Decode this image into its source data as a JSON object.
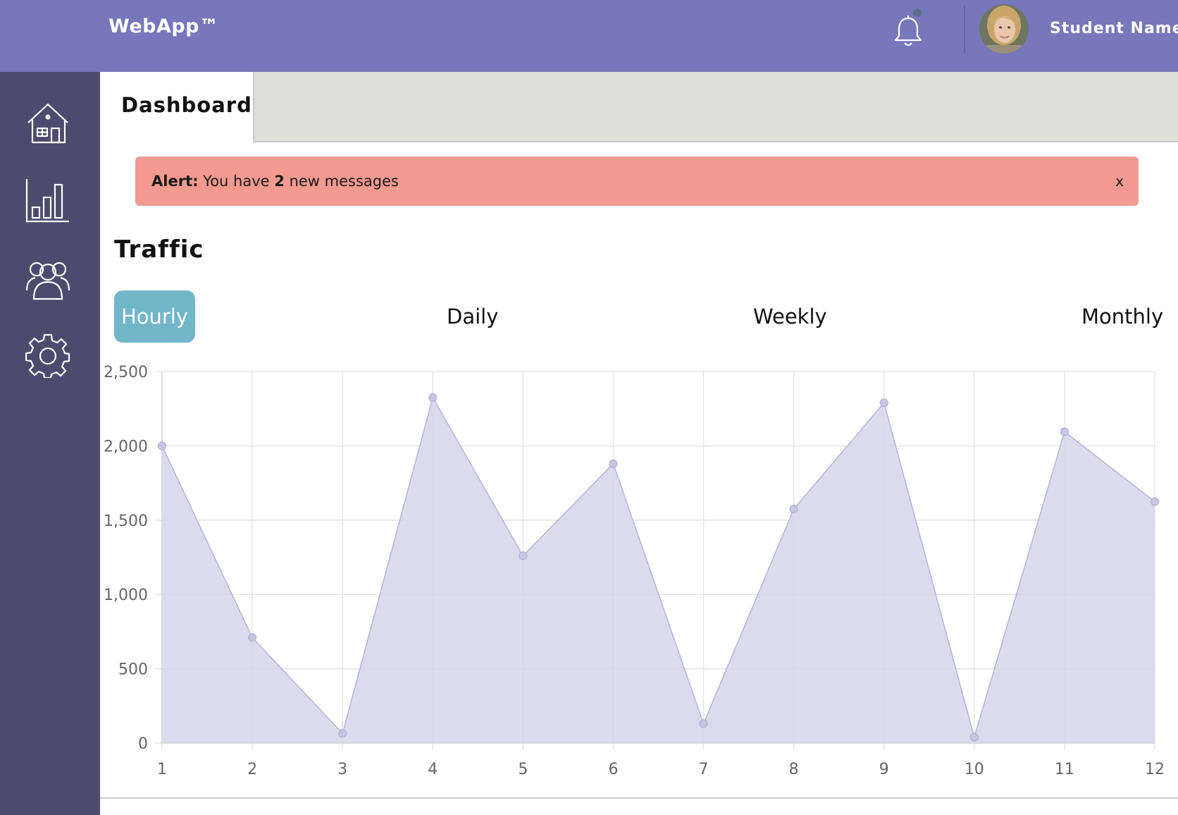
{
  "header": {
    "brand": "WebApp™",
    "user_name": "Student Name",
    "icons": [
      "bell-icon",
      "avatar"
    ]
  },
  "sidebar": {
    "items": [
      {
        "icon": "home-icon"
      },
      {
        "icon": "bar-chart-icon"
      },
      {
        "icon": "users-icon"
      },
      {
        "icon": "gear-icon"
      }
    ]
  },
  "tabs": {
    "active": "Dashboard"
  },
  "alert": {
    "label": "Alert:",
    "text_before": " You have ",
    "count": "2",
    "text_after": " new messages",
    "close": "x"
  },
  "traffic": {
    "title": "Traffic",
    "filters": {
      "hourly": "Hourly",
      "daily": "Daily",
      "weekly": "Weekly",
      "monthly": "Monthly"
    },
    "active_filter": "Hourly"
  },
  "colors": {
    "header": "#7777bb",
    "sidebar": "#4d4b6d",
    "alert": "#f49a90",
    "active_filter": "#71b6c9",
    "series_fill": "#d5d5ea",
    "series_line": "#b4b4db"
  },
  "chart_data": {
    "type": "area",
    "x": [
      1,
      2,
      3,
      4,
      5,
      6,
      7,
      8,
      9,
      10,
      11,
      12
    ],
    "values": [
      2000,
      710,
      65,
      2325,
      1260,
      1880,
      130,
      1575,
      2290,
      40,
      2095,
      1625
    ],
    "ylim": [
      0,
      2500
    ],
    "yticks": [
      0,
      500,
      1000,
      1500,
      2000,
      2500
    ],
    "ytick_labels": [
      "0",
      "500",
      "1,000",
      "1,500",
      "2,000",
      "2,500"
    ],
    "grid": true
  }
}
